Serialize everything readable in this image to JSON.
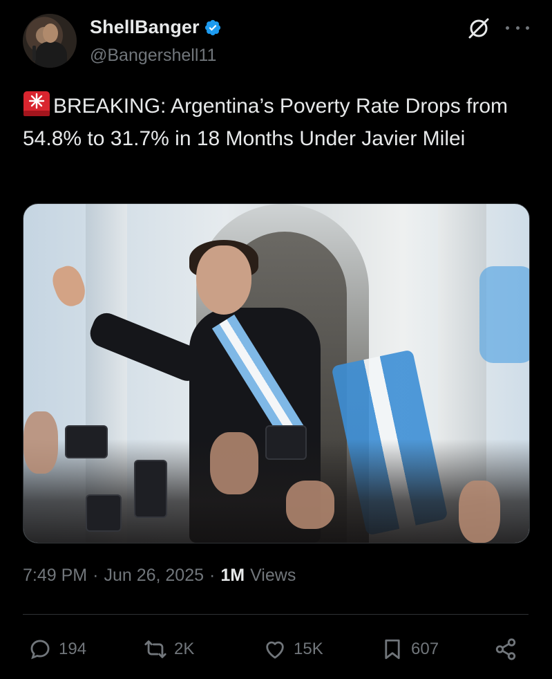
{
  "author": {
    "display_name": "ShellBanger",
    "handle": "@Bangershell11",
    "verified": true
  },
  "tweet": {
    "text": "BREAKING: Argentina’s Poverty Rate Drops from 54.8% to 31.7% in 18 Months Under Javier Milei",
    "leading_icon": "rotating-light-siren-icon"
  },
  "meta": {
    "time": "7:49 PM",
    "date": "Jun 26, 2025",
    "views_count": "1M",
    "views_label": "Views",
    "separator": "·"
  },
  "actions": {
    "replies": "194",
    "reposts": "2K",
    "likes": "15K",
    "bookmarks": "607"
  },
  "colors": {
    "background": "#000000",
    "text": "#e7e9ea",
    "secondary": "#71767b",
    "verified": "#1d9bf0",
    "divider": "#2f3336"
  }
}
